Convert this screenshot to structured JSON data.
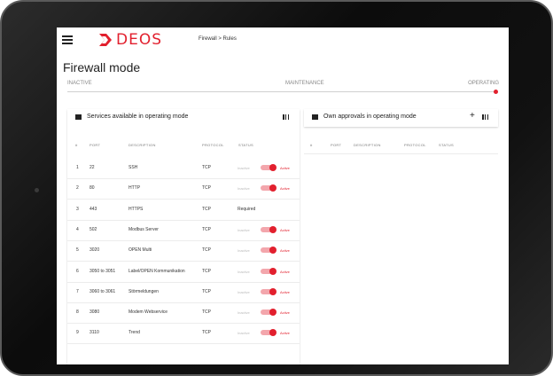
{
  "breadcrumb": "Firewall > Rules",
  "logo_text": "DEOS",
  "page_title": "Firewall mode",
  "modes": {
    "inactive": "INACTIVE",
    "maintenance": "MAINTENANCE",
    "operating": "OPERATING",
    "selected_fraction": 1.0
  },
  "left_panel": {
    "title": "Services available in operating mode",
    "columns": [
      "#",
      "PORT",
      "DESCRIPTION",
      "PROTOCOL",
      "STATUS"
    ],
    "rows": [
      {
        "num": "1",
        "port": "22",
        "description": "SSH",
        "protocol": "TCP",
        "status_type": "toggle",
        "inactive_label": "Inactive",
        "active_label": "Active"
      },
      {
        "num": "2",
        "port": "80",
        "description": "HTTP",
        "protocol": "TCP",
        "status_type": "toggle",
        "inactive_label": "Inactive",
        "active_label": "Active"
      },
      {
        "num": "3",
        "port": "443",
        "description": "HTTPS",
        "protocol": "TCP",
        "status_type": "text",
        "status_text": "Required"
      },
      {
        "num": "4",
        "port": "502",
        "description": "Modbus Server",
        "protocol": "TCP",
        "status_type": "toggle",
        "inactive_label": "Inactive",
        "active_label": "Active"
      },
      {
        "num": "5",
        "port": "3020",
        "description": "OPEN Multi",
        "protocol": "TCP",
        "status_type": "toggle",
        "inactive_label": "Inactive",
        "active_label": "Active"
      },
      {
        "num": "6",
        "port": "3050 to 3051",
        "description": "Label/OPEN Kommunikation",
        "protocol": "TCP",
        "status_type": "toggle",
        "inactive_label": "Inactive",
        "active_label": "Active"
      },
      {
        "num": "7",
        "port": "3060 to 3061",
        "description": "Störmeldungen",
        "protocol": "TCP",
        "status_type": "toggle",
        "inactive_label": "Inactive",
        "active_label": "Active"
      },
      {
        "num": "8",
        "port": "3080",
        "description": "Modem Webservice",
        "protocol": "TCP",
        "status_type": "toggle",
        "inactive_label": "Inactive",
        "active_label": "Active"
      },
      {
        "num": "9",
        "port": "3110",
        "description": "Trend",
        "protocol": "TCP",
        "status_type": "toggle",
        "inactive_label": "Inactive",
        "active_label": "Active"
      }
    ]
  },
  "right_panel": {
    "title": "Own approvals in operating mode",
    "columns": [
      "#",
      "PORT",
      "DESCRIPTION",
      "PROTOCOL",
      "STATUS"
    ]
  },
  "colors": {
    "accent": "#e2202e",
    "toggle_track": "#f3a6ac"
  },
  "icons": [
    "menu-icon",
    "deos-logo",
    "list-icon",
    "columns-icon",
    "plus-icon"
  ]
}
